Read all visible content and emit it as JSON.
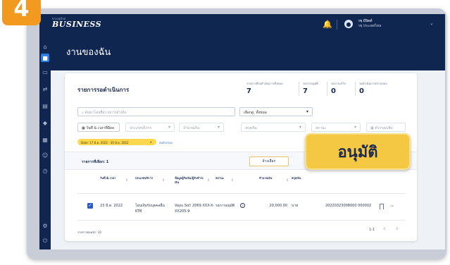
{
  "step_number": "4",
  "brand": {
    "small": "krungthai",
    "name": "BUSINESS"
  },
  "user": {
    "name": "วชฺ มีจิตต์",
    "company": "วชฺ ประเทศไทย"
  },
  "page_title": "งานของฉัน",
  "card": {
    "title": "รายการรอดำเนินการ",
    "summary": [
      {
        "label": "รายการที่รอดำเนินการทั้งหมด",
        "value": "7"
      },
      {
        "label": "รอการอนุมัติ",
        "value": "7"
      },
      {
        "label": "รอการแก้ไข",
        "value": "0"
      },
      {
        "label": "รอดำเนินการตรวจสอบ",
        "value": "0"
      }
    ]
  },
  "filters": {
    "search_placeholder": "ค้นหาโดยชื่อรายการอ้างอิง",
    "select_type": "เลือกดู: ทั้งหมด",
    "date_range": "วันที่ & เวลาที่มีผล",
    "service_type": "ประเภทบริการ",
    "amount": "จำนวนเงิน",
    "currency": "สกุลเงิน",
    "status": "สถานะ",
    "more_filters": "ตัวกรองเพิ่ม",
    "active_chip": "Date: 17 มี.ค. 2022 - 30 มี.ค. 2022",
    "chip_close": "✕",
    "clear_label": "ลบตัวกรอง"
  },
  "selection": {
    "count_label": "รายการที่เลือก: 1",
    "cancel_label": "ล้างเลือก"
  },
  "table": {
    "headers": [
      "วันที่ & เวลา",
      "ประเภทบริการ",
      "ข้อมูลผู้รับเงิน/ผู้รับชำระเงิน",
      "สถานะ",
      "จำนวนเงิน",
      "สกุลเงิน"
    ],
    "row": {
      "date": "23 มี.ค. 2022",
      "service": "โอนเงินรับบุคคลอื่น KTB",
      "payee": "Vayu Sol! 2069 XXX-X-XX205-9",
      "status": "รอการอนุมัติ",
      "amount": "20,000.00",
      "currency": "บาท",
      "reference": "20220323008000 000002"
    }
  },
  "footer": {
    "per_page": "รายการต่อหน้า: 10",
    "page_info": "1-1"
  },
  "callout": {
    "label": "อนุมัติ"
  },
  "colors": {
    "navy": "#0f2650",
    "accent_blue": "#2a7de1",
    "badge_orange": "#f29a1f",
    "callout_yellow": "#f5c844",
    "chip_yellow": "#ffd84d"
  }
}
